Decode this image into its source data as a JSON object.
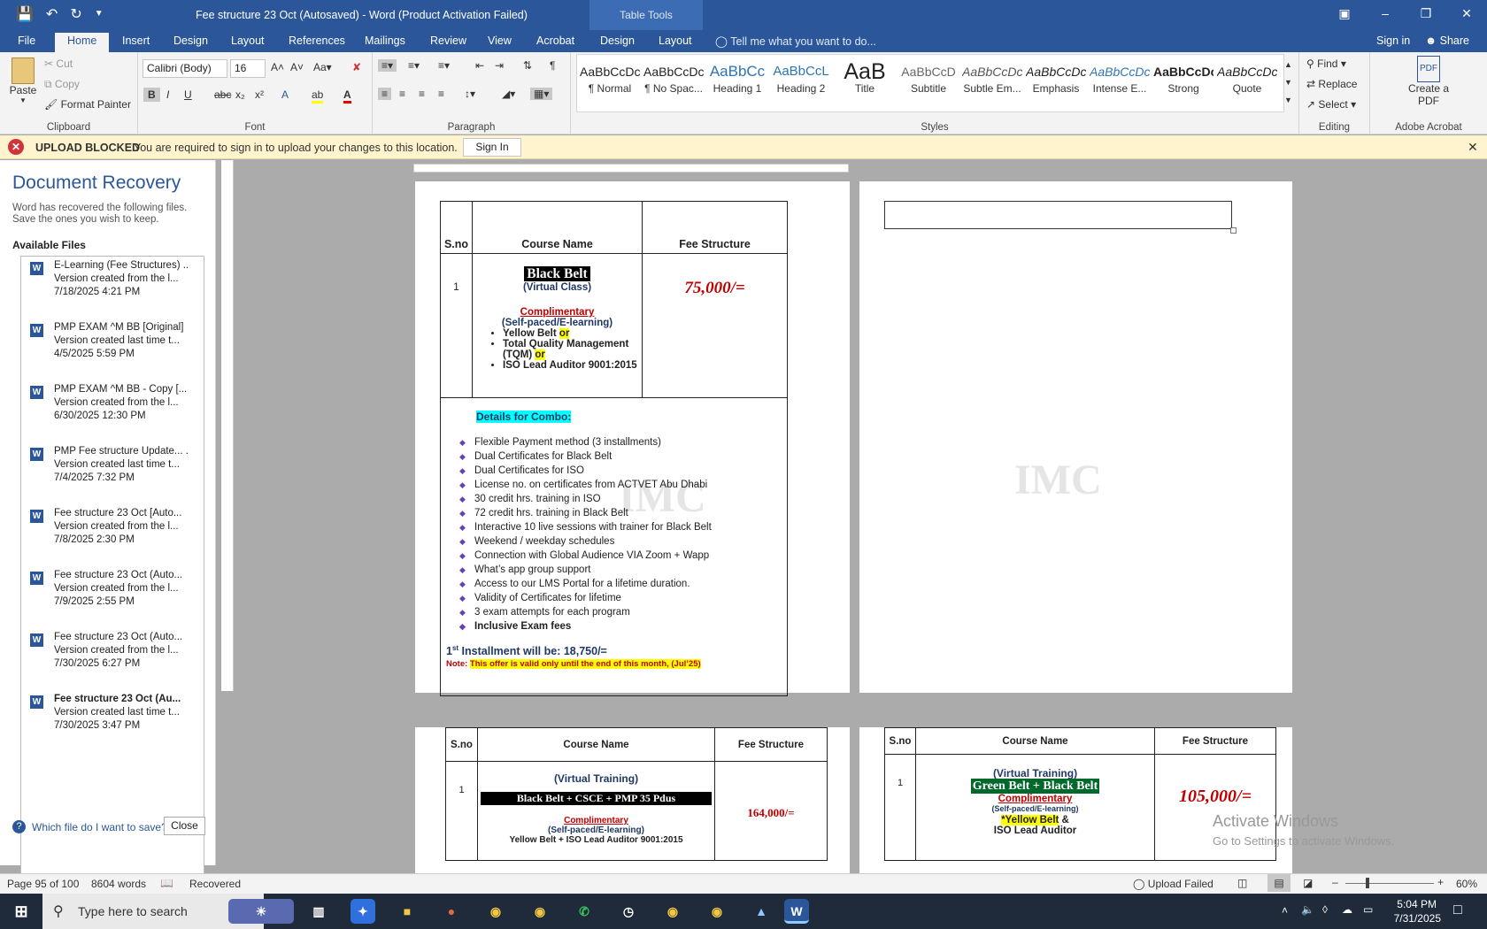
{
  "window": {
    "title": "Fee structure 23 Oct (Autosaved) - Word (Product Activation Failed)",
    "table_tools": "Table Tools"
  },
  "tabs": [
    "File",
    "Home",
    "Insert",
    "Design",
    "Layout",
    "References",
    "Mailings",
    "Review",
    "View",
    "Acrobat",
    "Design",
    "Layout"
  ],
  "tell_me": "Tell me what you want to do...",
  "sign_in": "Sign in",
  "share": "Share",
  "ribbon": {
    "clipboard": {
      "label": "Clipboard",
      "paste": "Paste",
      "cut": "Cut",
      "copy": "Copy",
      "format_painter": "Format Painter"
    },
    "font": {
      "label": "Font",
      "family": "Calibri (Body)",
      "size": "16"
    },
    "paragraph": {
      "label": "Paragraph"
    },
    "styles": {
      "label": "Styles",
      "items": [
        {
          "sample": "AaBbCcDc",
          "name": "¶ Normal"
        },
        {
          "sample": "AaBbCcDc",
          "name": "¶ No Spac..."
        },
        {
          "sample": "AaBbCc",
          "name": "Heading 1"
        },
        {
          "sample": "AaBbCcL",
          "name": "Heading 2"
        },
        {
          "sample": "AaB",
          "name": "Title"
        },
        {
          "sample": "AaBbCcD",
          "name": "Subtitle"
        },
        {
          "sample": "AaBbCcDc",
          "name": "Subtle Em..."
        },
        {
          "sample": "AaBbCcDc",
          "name": "Emphasis"
        },
        {
          "sample": "AaBbCcDc",
          "name": "Intense E..."
        },
        {
          "sample": "AaBbCcDc",
          "name": "Strong"
        },
        {
          "sample": "AaBbCcDc",
          "name": "Quote"
        }
      ]
    },
    "editing": {
      "label": "Editing",
      "find": "Find",
      "replace": "Replace",
      "select": "Select"
    },
    "acrobat": {
      "label": "Adobe Acrobat",
      "create_pdf": "Create a PDF"
    }
  },
  "message_bar": {
    "title": "UPLOAD BLOCKED",
    "text": "You are required to sign in to upload your changes to this location.",
    "button": "Sign In"
  },
  "recovery": {
    "title": "Document Recovery",
    "description": "Word has recovered the following files. Save the ones you wish to keep.",
    "available": "Available Files",
    "files": [
      {
        "name": "E-Learning (Fee Structures) ..",
        "desc": "Version created from the l...",
        "date": "7/18/2025 4:21 PM"
      },
      {
        "name": "PMP EXAM ^M BB  [Original]",
        "desc": "Version created last time t...",
        "date": "4/5/2025 5:59 PM"
      },
      {
        "name": "PMP EXAM ^M BB - Copy  [...",
        "desc": "Version created from the l...",
        "date": "6/30/2025 12:30 PM"
      },
      {
        "name": "PMP Fee structure Update... .",
        "desc": "Version created last time t...",
        "date": "7/4/2025 7:32 PM"
      },
      {
        "name": "Fee structure 23 Oct  [Auto...",
        "desc": "Version created from the l...",
        "date": "7/8/2025 2:30 PM"
      },
      {
        "name": "Fee structure 23 Oct (Auto...",
        "desc": "Version created from the l...",
        "date": "7/9/2025 2:55 PM"
      },
      {
        "name": "Fee structure 23 Oct (Auto...",
        "desc": "Version created from the l...",
        "date": "7/30/2025 6:27 PM"
      },
      {
        "name": "Fee structure 23 Oct (Au...",
        "desc": "Version created last time t...",
        "date": "7/30/2025 3:47 PM"
      }
    ],
    "which_file": "Which file do I want to save?",
    "close": "Close"
  },
  "page1": {
    "h_sno": "S.no",
    "h_course": "Course Name",
    "h_fee": "Fee Structure",
    "sno": "1",
    "course_title": "Black Belt",
    "virtual": "(Virtual Class)",
    "complimentary": "Complimentary",
    "selfpaced": "(Self-paced/E-learning)",
    "b1": "Yellow Belt ",
    "or": "or",
    "b2a": "Total Quality Management",
    "b2b": "(TQM) ",
    "b3": "ISO Lead Auditor 9001:2015",
    "fee": "75,000/=",
    "combo_title": "Details for Combo:",
    "combo": [
      "Flexible Payment method (3 installments)",
      "Dual Certificates for Black Belt",
      "Dual Certificates for ISO",
      "License no. on certificates from ACTVET Abu Dhabi",
      "30 credit hrs. training in ISO",
      "72 credit hrs. training in Black Belt",
      " Interactive 10 live sessions with trainer for Black Belt",
      "Weekend / weekday schedules",
      " Connection with Global Audience VIA Zoom + Wapp",
      "What’s app group support",
      "Access to our LMS Portal for a lifetime duration.",
      "Validity of Certificates for lifetime",
      "3 exam attempts for each program",
      "Inclusive Exam fees"
    ],
    "installment_a": "1",
    "installment_sup": "st",
    "installment_b": " Installment will be: 18,750/=",
    "note_label": "Note:",
    "note": "This offer is valid only until the end of this month, (Jul’25)"
  },
  "page3": {
    "h_sno": "S.no",
    "h_course": "Course Name",
    "h_fee": "Fee Structure",
    "sno": "1",
    "virtual": "(Virtual Training)",
    "course": "Black Belt + CSCE + PMP 35 Pdus",
    "complimentary": "Complimentary",
    "selfpaced": "(Self-paced/E-learning)",
    "extra": "Yellow Belt + ISO Lead Auditor 9001:2015",
    "fee": "164,000/="
  },
  "page4": {
    "h_sno": "S.no",
    "h_course": "Course Name",
    "h_fee": "Fee Structure",
    "sno": "1",
    "virtual": "(Virtual Training)",
    "course": "Green Belt + Black Belt",
    "complimentary": "Complimentary",
    "selfpaced": "(Self-paced/E-learning)",
    "yb": "*Yellow Belt",
    "amp": " &",
    "iso": "ISO Lead Auditor",
    "fee": "105,000/="
  },
  "watermark": "IMC",
  "activate": {
    "line1": "Activate Windows",
    "line2": "Go to Settings to activate Windows."
  },
  "status": {
    "page": "Page 95 of 100",
    "words": "8604 words",
    "recovered": "Recovered",
    "upload": "Upload Failed",
    "zoom": "60%"
  },
  "taskbar": {
    "search": "Type here to search",
    "time": "5:04 PM",
    "date": "7/31/2025"
  },
  "colors": {
    "word_blue": "#2b579a",
    "fee_red": "#c00000",
    "green": "#00b050"
  }
}
